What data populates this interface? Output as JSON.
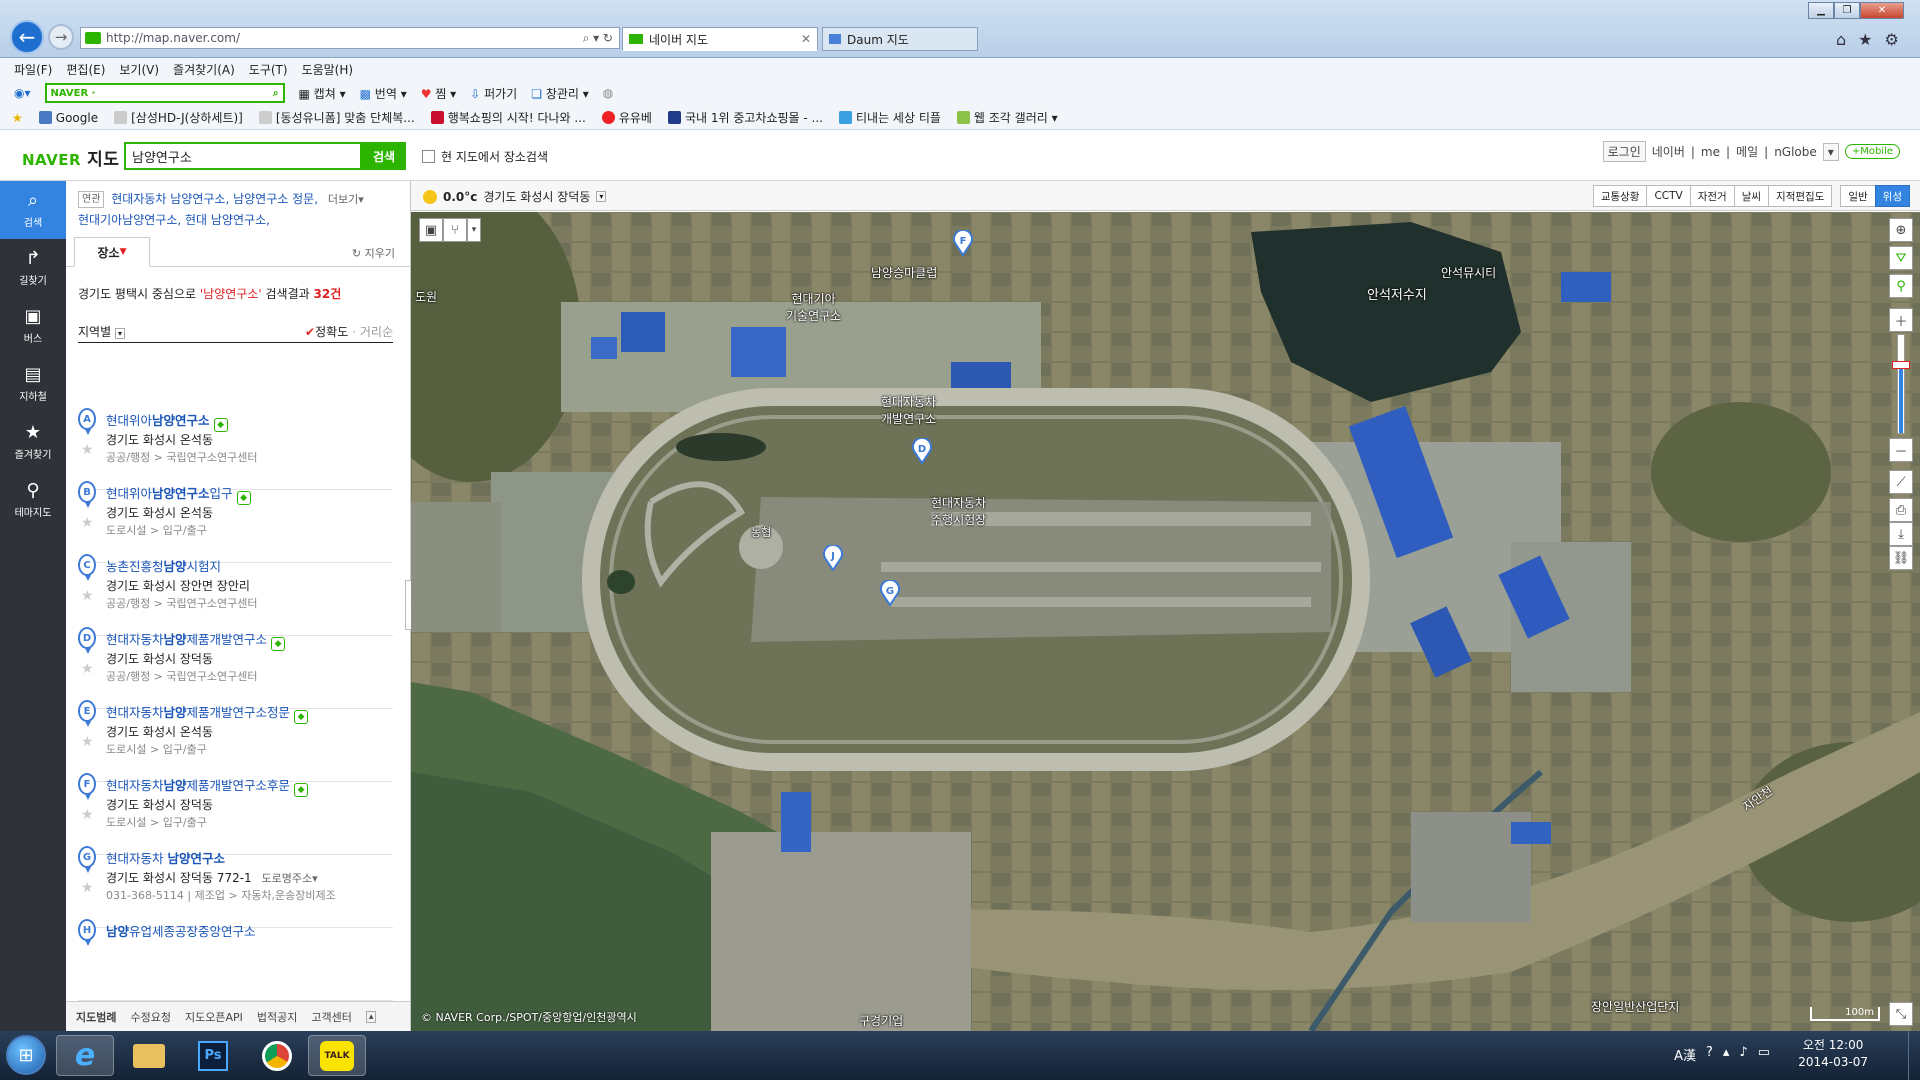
{
  "browser": {
    "address": "http://map.naver.com/",
    "tabs": [
      {
        "label": "네이버 지도",
        "active": true
      },
      {
        "label": "Daum 지도",
        "active": false
      }
    ],
    "menu": [
      "파일(F)",
      "편집(E)",
      "보기(V)",
      "즐겨찾기(A)",
      "도구(T)",
      "도움말(H)"
    ],
    "commands": {
      "naver_search": "NAVER ·",
      "capture": "캡쳐",
      "translate": "번역",
      "pick": "찜",
      "spread": "퍼가기",
      "window_mgr": "창관리"
    },
    "favorites": [
      "Google",
      "[삼성HD-J(상하세트)]",
      "[동성유니폼] 맞춤 단체복...",
      "행복쇼핑의 시작! 다나와 ...",
      "유유베",
      "국내 1위 중고차쇼핑몰 - ...",
      "티내는 세상 티플",
      "웹 조각 갤러리"
    ]
  },
  "header": {
    "logo": "NAVER",
    "logo_sub": "지도",
    "query": "남양연구소",
    "search_button": "검색",
    "current_map_search": "현 지도에서 장소검색",
    "links": {
      "login": "로그인",
      "naver": "네이버",
      "me": "me",
      "mail": "메일",
      "nglobe": "nGlobe",
      "mobile": "+Mobile"
    }
  },
  "leftnav": [
    {
      "label": "검색",
      "icon": "search-icon",
      "glyph": "⌕"
    },
    {
      "label": "길찾기",
      "icon": "route-icon",
      "glyph": "↱"
    },
    {
      "label": "버스",
      "icon": "bus-icon",
      "glyph": "▣"
    },
    {
      "label": "지하철",
      "icon": "subway-icon",
      "glyph": "▤"
    },
    {
      "label": "즐겨찾기",
      "icon": "star-icon",
      "glyph": "★"
    },
    {
      "label": "테마지도",
      "icon": "pin-icon",
      "glyph": "⚲"
    }
  ],
  "panel": {
    "related_tag": "연관",
    "related": [
      "현대자동차 남양연구소,",
      "남양연구소 정문,",
      "현대기아남양연구소,",
      "현대 남양연구소,"
    ],
    "more": "더보기",
    "tab": "장소",
    "reset": "지우기",
    "summary_prefix": "경기도 평택시 중심으로",
    "summary_query": "'남양연구소'",
    "summary_mid": "검색결과",
    "summary_count": "32건",
    "region_filter": "지역별",
    "sort_accuracy": "정확도",
    "sort_distance": "거리순",
    "results": [
      {
        "letter": "A",
        "pre": "현대위아",
        "hl": "남양연구소",
        "post": "",
        "addr": "경기도 화성시 온석동",
        "cat": "공공/행정 > 국립연구소연구센터",
        "badge": true
      },
      {
        "letter": "B",
        "pre": "현대위아",
        "hl": "남양연구소",
        "post": "입구",
        "addr": "경기도 화성시 온석동",
        "cat": "도로시설 > 입구/출구",
        "badge": true
      },
      {
        "letter": "C",
        "pre": "농촌진흥청",
        "hl": "남양",
        "post": "시험지",
        "addr": "경기도 화성시 장안면 장안리",
        "cat": "공공/행정 > 국립연구소연구센터",
        "badge": false
      },
      {
        "letter": "D",
        "pre": "현대자동차",
        "hl": "남양",
        "post": "제품개발연구소",
        "addr": "경기도 화성시 장덕동",
        "cat": "공공/행정 > 국립연구소연구센터",
        "badge": true
      },
      {
        "letter": "E",
        "pre": "현대자동차",
        "hl": "남양",
        "post": "제품개발연구소정문",
        "addr": "경기도 화성시 온석동",
        "cat": "도로시설 > 입구/출구",
        "badge": true
      },
      {
        "letter": "F",
        "pre": "현대자동차",
        "hl": "남양",
        "post": "제품개발연구소후문",
        "addr": "경기도 화성시 장덕동",
        "cat": "도로시설 > 입구/출구",
        "badge": true
      },
      {
        "letter": "G",
        "pre": "현대자동차 ",
        "hl": "남양연구소",
        "post": "",
        "addr": "경기도 화성시 장덕동 772-1",
        "addr_extra": "도로명주소",
        "cat": "031-368-5114 | 제조업 > 자동차,운송장비제조",
        "badge": false
      },
      {
        "letter": "H",
        "pre": "",
        "hl": "남양",
        "post": "유업세종공장중앙연구소",
        "addr": "",
        "cat": "",
        "badge": false
      }
    ],
    "footer": [
      "지도범례",
      "수정요청",
      "지도오픈API",
      "법적공지",
      "고객센터"
    ]
  },
  "map": {
    "weather_temp": "0.0°c",
    "weather_loc": "경기도 화성시 장덕동",
    "layers": [
      "교통상황",
      "CCTV",
      "자전거",
      "날씨",
      "지적편집도",
      "일반",
      "위성"
    ],
    "active_layer": "위성",
    "labels": {
      "test_track": "현대자동차\n주행시험장",
      "dev_center": "현대자동차\n개발연구소",
      "kia_center": "현대기아\n기술연구소",
      "namyang_club": "남양승마클럽",
      "reservoir": "안석저수지",
      "anseok": "안석뮤시티",
      "nonghyup": "농협",
      "river": "자안천",
      "industrial": "장안일반산업단지",
      "company": "구경기업",
      "corner": "도원"
    },
    "markers": [
      "F",
      "D",
      "J",
      "G"
    ],
    "copyright": "© NAVER Corp./SPOT/중앙항업/인천광역시",
    "scale": "100m"
  },
  "taskbar": {
    "clock_time": "오전 12:00",
    "clock_date": "2014-03-07",
    "apps": [
      "ie-icon",
      "explorer-icon",
      "photoshop-icon",
      "chrome-icon",
      "kakaotalk-icon"
    ],
    "ps_label": "Ps",
    "talk_label": "TALK"
  }
}
